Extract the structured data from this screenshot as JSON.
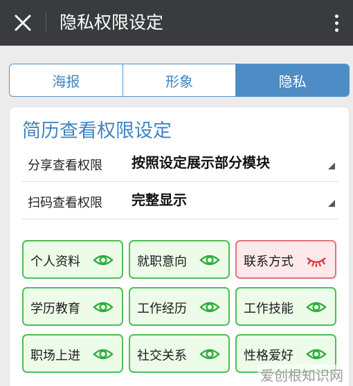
{
  "header": {
    "title": "隐私权限设定"
  },
  "tabs": [
    {
      "label": "海报",
      "active": false
    },
    {
      "label": "形象",
      "active": false
    },
    {
      "label": "隐私",
      "active": true
    }
  ],
  "section": {
    "title": "简历查看权限设定",
    "settings": [
      {
        "label": "分享查看权限",
        "value": "按照设定展示部分模块"
      },
      {
        "label": "扫码查看权限",
        "value": "完整显示"
      }
    ]
  },
  "modules": [
    {
      "label": "个人资料",
      "visible": true
    },
    {
      "label": "就职意向",
      "visible": true
    },
    {
      "label": "联系方式",
      "visible": false
    },
    {
      "label": "学历教育",
      "visible": true
    },
    {
      "label": "工作经历",
      "visible": true
    },
    {
      "label": "工作技能",
      "visible": true
    },
    {
      "label": "职场上进",
      "visible": true
    },
    {
      "label": "社交关系",
      "visible": true
    },
    {
      "label": "性格爱好",
      "visible": true
    }
  ],
  "watermark": "爱创根知识网",
  "colors": {
    "appbar": "#3a3b3f",
    "accent": "#3f84c1",
    "visible_green": "#4cbf52",
    "hidden_red": "#e2727a"
  },
  "icons": {
    "visible": "eye-open-icon",
    "hidden": "eye-closed-icon"
  }
}
